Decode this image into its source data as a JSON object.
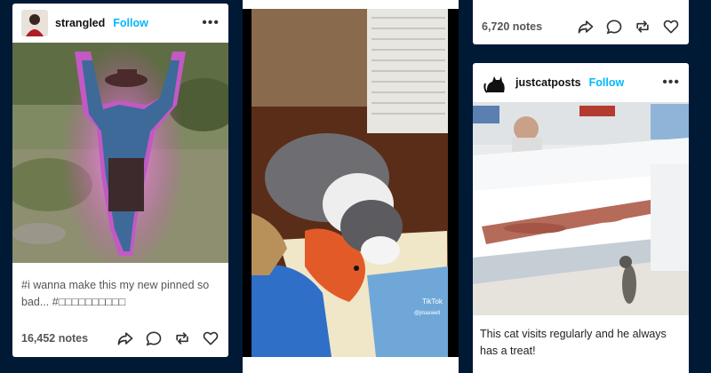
{
  "posts": [
    {
      "blog_name": "strangled",
      "follow_label": "Follow",
      "more_label": "•••",
      "caption": "#i wanna make this my new pinned so bad...  #□□□□□□□□□□",
      "notes": "16,452 notes"
    },
    {
      "video_watermark": "TikTok",
      "video_watermark_user": "@jmaxwell"
    },
    {
      "notes": "6,720 notes"
    },
    {
      "blog_name": "justcatposts",
      "follow_label": "Follow",
      "more_label": "•••",
      "caption": "This cat visits regularly and he always has a treat!"
    }
  ],
  "icons": [
    "share-icon",
    "reply-icon",
    "reblog-icon",
    "like-icon"
  ],
  "colors": {
    "background": "#001935",
    "follow": "#00b8ff"
  }
}
